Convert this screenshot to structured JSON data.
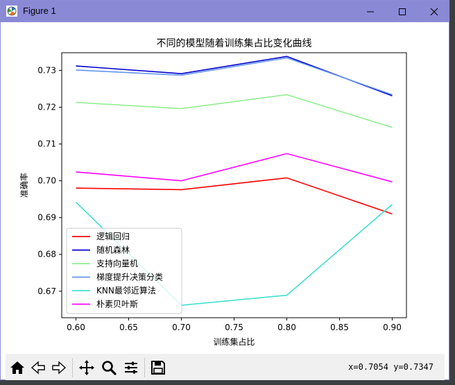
{
  "window": {
    "title": "Figure 1"
  },
  "toolbar": {
    "buttons": [
      "home-icon",
      "back-icon",
      "forward-icon",
      "pan-icon",
      "zoom-icon",
      "configure-subplots-icon",
      "save-icon"
    ],
    "coordinates": "x=0.7054 y=0.7347"
  },
  "chart_data": {
    "type": "line",
    "title": "不同的模型随着训练集占比变化曲线",
    "xlabel": "训练集占比",
    "ylabel": "准确率",
    "x": [
      0.6,
      0.7,
      0.8,
      0.9
    ],
    "xticks": [
      "0.60",
      "0.65",
      "0.70",
      "0.75",
      "0.80",
      "0.85",
      "0.90"
    ],
    "yticks": [
      "0.67",
      "0.68",
      "0.69",
      "0.70",
      "0.71",
      "0.72",
      "0.73"
    ],
    "xlim": [
      0.5865,
      0.9135
    ],
    "ylim": [
      0.6628,
      0.7348
    ],
    "legend_position": "lower-left",
    "grid": false,
    "series": [
      {
        "name": "逻辑回归",
        "color": "#ff0000",
        "values": [
          0.698,
          0.6976,
          0.7008,
          0.691
        ]
      },
      {
        "name": "随机森林",
        "color": "#0000cd",
        "values": [
          0.7312,
          0.7291,
          0.7338,
          0.7231
        ]
      },
      {
        "name": "支持向量机",
        "color": "#90ee90",
        "values": [
          0.7213,
          0.7196,
          0.7234,
          0.7145
        ]
      },
      {
        "name": "梯度提升决策分类",
        "color": "#6495ed",
        "values": [
          0.7301,
          0.7287,
          0.7334,
          0.7234
        ]
      },
      {
        "name": "KNN最邻近算法",
        "color": "#40e0d0",
        "values": [
          0.6942,
          0.6662,
          0.6689,
          0.6936
        ]
      },
      {
        "name": "朴素贝叶斯",
        "color": "#ff00ff",
        "values": [
          0.7024,
          0.7,
          0.7074,
          0.6997
        ]
      }
    ]
  }
}
